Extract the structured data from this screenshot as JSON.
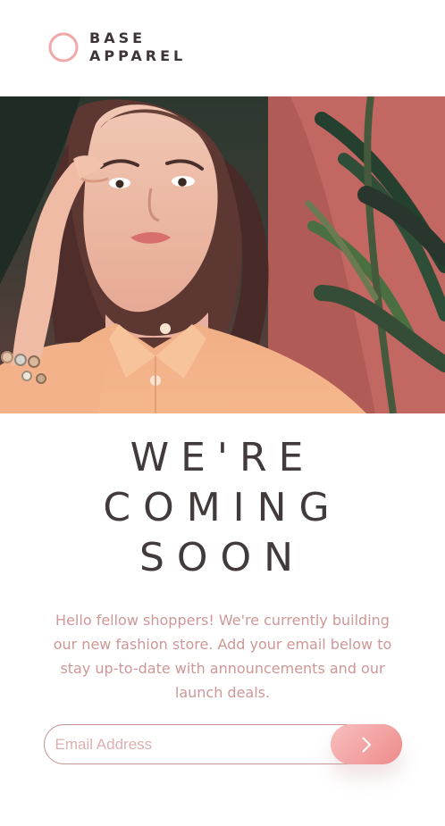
{
  "brand": {
    "line1": "BASE",
    "line2": "APPAREL",
    "accent_color": "#ce9797",
    "text_color": "#3d3536"
  },
  "hero": {
    "image": "woman-in-peach-shirt-with-tropical-leaves-background"
  },
  "headline": {
    "accent": "WE'RE",
    "line2": "COMING",
    "line3": "SOON"
  },
  "copy": {
    "body": "Hello fellow shoppers! We're currently building our new fashion store. Add your email below to stay up-to-date with announcements and our launch deals."
  },
  "form": {
    "email_placeholder": "Email Address",
    "submit_icon": "chevron-right-icon",
    "button_color": "#f28e8e"
  }
}
